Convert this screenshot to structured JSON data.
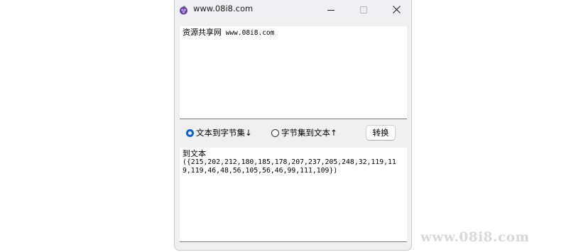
{
  "window": {
    "title": "www.08i8.com",
    "app_icon": "purple-grape-icon",
    "controls": {
      "minimize_icon": "minimize-icon",
      "maximize_icon": "maximize-icon",
      "close_icon": "close-icon"
    }
  },
  "input": {
    "label_cjk": "资源共享网",
    "label_url": " www.08i8.com"
  },
  "options": {
    "text_to_bytes": "文本到字节集↓",
    "bytes_to_text": "字节集到文本↑",
    "selected": "text_to_bytes"
  },
  "convert_button": "转换",
  "output": {
    "title": "到文本",
    "bytes": "({215,202,212,180,185,178,207,237,205,248,32,119,119,119,46,48,56,105,56,46,99,111,109})"
  },
  "watermark": "www.08i8.com",
  "colors": {
    "accent": "#0a5fd1",
    "icon_purple": "#6a3fa0"
  }
}
